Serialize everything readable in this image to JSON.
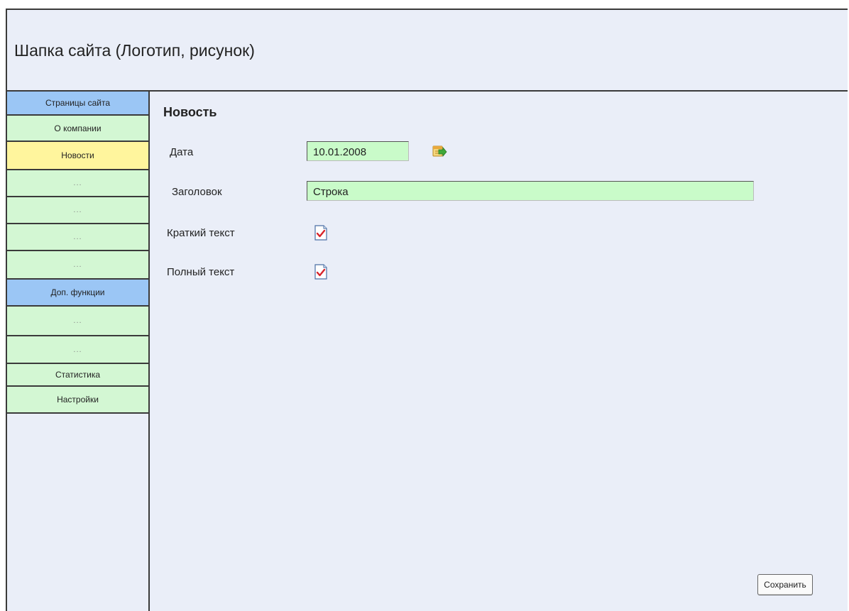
{
  "header": {
    "title": "Шапка сайта (Логотип, рисунок)"
  },
  "sidebar": {
    "items": [
      {
        "label": "Страницы сайта",
        "kind": "section"
      },
      {
        "label": "О компании",
        "kind": "link"
      },
      {
        "label": "Новости",
        "kind": "active"
      },
      {
        "label": "...",
        "kind": "link"
      },
      {
        "label": "...",
        "kind": "link"
      },
      {
        "label": "...",
        "kind": "link"
      },
      {
        "label": "...",
        "kind": "link"
      },
      {
        "label": "Доп. функции",
        "kind": "section"
      },
      {
        "label": "...",
        "kind": "link"
      },
      {
        "label": "...",
        "kind": "link"
      },
      {
        "label": "Статистика",
        "kind": "link"
      },
      {
        "label": "Настройки",
        "kind": "link"
      }
    ]
  },
  "form": {
    "title": "Новость",
    "date_label": "Дата",
    "date_value": "10.01.2008",
    "date_icon": "calendar-go-icon",
    "heading_label": "Заголовок",
    "heading_value": "Строка",
    "short_text_label": "Краткий текст",
    "short_text_icon": "edit-document-icon",
    "full_text_label": "Полный текст",
    "full_text_icon": "edit-document-icon",
    "save_label": "Сохранить"
  },
  "colors": {
    "background": "#eaeef8",
    "section": "#9bc6f5",
    "link": "#d3f7d3",
    "active": "#fff59d",
    "input": "#c9fbc9"
  }
}
